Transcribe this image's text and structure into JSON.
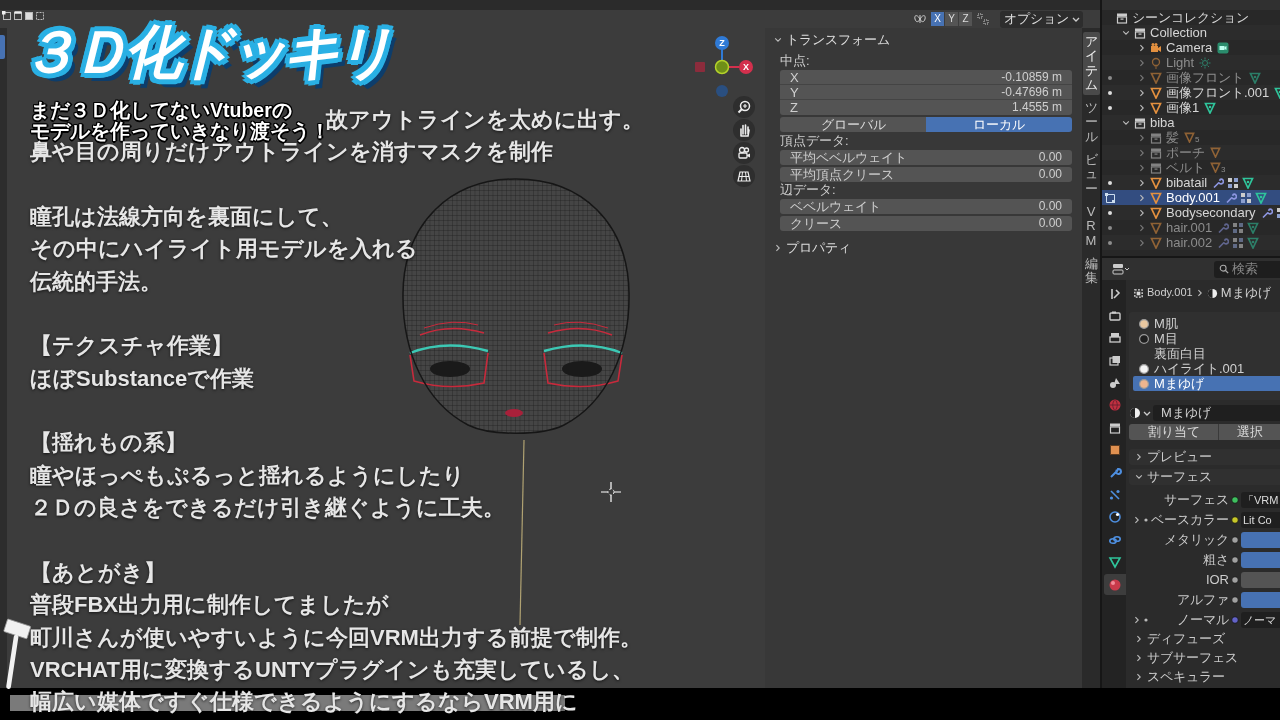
{
  "title_overlay": {
    "title": "３Ｄ化ドッキリ",
    "subtitle_lines": [
      "まだ３Ｄ化してないVtuberの",
      "モデルを作っていきなり渡そう！"
    ]
  },
  "caption": {
    "partly_covered_line": "故アウトラインを太めに出す。",
    "paragraphs": [
      [
        "鼻や目の周りだけアウトラインを消すマスクを制作"
      ],
      [
        "瞳孔は法線方向を裏面にして、",
        "その中にハイライト用モデルを入れる",
        "伝統的手法。"
      ],
      [
        "【テクスチャ作業】",
        "ほぼSubstanceで作業"
      ],
      [
        "【揺れもの系】",
        "瞳やほっぺもぷるっと揺れるようにしたり",
        "２Ｄの良さをできるだけ引き継ぐように工夫。"
      ],
      [
        "【あとがき】",
        "普段FBX出力用に制作してましたが",
        "町川さんが使いやすいように今回VRM出力する前提で制作。",
        "VRCHAT用に変換するUNTYプラグインも充実しているし、",
        "幅広い媒体ですぐ仕様できるようにするならVRM用に"
      ]
    ]
  },
  "viewport_header": {
    "mirror_axes": [
      {
        "label": "X",
        "selected": true
      },
      {
        "label": "Y",
        "selected": false
      },
      {
        "label": "Z",
        "selected": false
      }
    ],
    "options_menu": "オプション"
  },
  "gizmo": {
    "z_label": "Z",
    "x_label": "X"
  },
  "sidebar": {
    "transform": {
      "title": "トランスフォーム",
      "expanded": true,
      "median_label": "中点:",
      "median": [
        {
          "axis": "X",
          "value": "-0.10859 m"
        },
        {
          "axis": "Y",
          "value": "-0.47696 m"
        },
        {
          "axis": "Z",
          "value": "1.4555 m"
        }
      ],
      "space": [
        {
          "label": "グローバル",
          "selected": false
        },
        {
          "label": "ローカル",
          "selected": true
        }
      ],
      "groups": [
        {
          "label": "頂点データ:",
          "fields": [
            {
              "label": "平均ベベルウェイト",
              "value": "0.00"
            },
            {
              "label": "平均頂点クリース",
              "value": "0.00"
            }
          ]
        },
        {
          "label": "辺データ:",
          "fields": [
            {
              "label": "ベベルウェイト",
              "value": "0.00"
            },
            {
              "label": "クリース",
              "value": "0.00"
            }
          ]
        }
      ]
    },
    "properties_panel": {
      "title": "プロパティ",
      "expanded": false
    },
    "tabs": [
      {
        "label": "アイテム",
        "selected": true
      },
      {
        "label": "ツール",
        "selected": false
      },
      {
        "label": "ビュー",
        "selected": false
      },
      {
        "label": "VRM",
        "selected": false
      },
      {
        "label": "編集",
        "selected": false
      }
    ]
  },
  "outliner": {
    "root": "シーンコレクション",
    "items": [
      {
        "kind": "collection",
        "label": "Collection",
        "expanded": true,
        "hidden": false,
        "selected": false,
        "edit_toggle": false,
        "edit_mode": false,
        "children": [
          {
            "kind": "camera",
            "label": "Camera",
            "expanded": false,
            "hidden": false,
            "selected": false,
            "edit_toggle": false,
            "edit_mode": false
          },
          {
            "kind": "light",
            "label": "Light",
            "expanded": false,
            "hidden": true,
            "selected": false,
            "edit_toggle": false,
            "edit_mode": false
          },
          {
            "kind": "mesh",
            "label": "画像フロント",
            "expanded": false,
            "hidden": true,
            "selected": false,
            "edit_toggle": true,
            "edit_mode": false
          },
          {
            "kind": "mesh",
            "label": "画像フロント.001",
            "expanded": false,
            "hidden": false,
            "selected": false,
            "edit_toggle": true,
            "edit_mode": false
          },
          {
            "kind": "mesh",
            "label": "画像1",
            "expanded": false,
            "hidden": false,
            "selected": false,
            "edit_toggle": true,
            "edit_mode": false
          }
        ]
      },
      {
        "kind": "collection",
        "label": "biba",
        "expanded": true,
        "hidden": false,
        "selected": false,
        "edit_toggle": false,
        "edit_mode": false,
        "children": [
          {
            "kind": "collection",
            "label": "髪",
            "expanded": false,
            "hidden": true,
            "selected": false,
            "edit_toggle": false,
            "edit_mode": false,
            "count": "5"
          },
          {
            "kind": "collection",
            "label": "ポーチ",
            "expanded": false,
            "hidden": true,
            "selected": false,
            "edit_toggle": false,
            "edit_mode": false
          },
          {
            "kind": "collection",
            "label": "ベルト",
            "expanded": false,
            "hidden": true,
            "selected": false,
            "edit_toggle": false,
            "edit_mode": false,
            "count": "3"
          },
          {
            "kind": "mesh",
            "label": "bibatail",
            "expanded": false,
            "hidden": false,
            "selected": false,
            "edit_toggle": true,
            "edit_mode": false,
            "modifiers": true
          },
          {
            "kind": "mesh",
            "label": "Body.001",
            "expanded": false,
            "hidden": false,
            "selected": true,
            "edit_mode": true,
            "modifiers": true
          },
          {
            "kind": "mesh",
            "label": "Bodysecondary",
            "expanded": false,
            "hidden": false,
            "selected": false,
            "edit_toggle": true,
            "edit_mode": false,
            "modifiers": true
          },
          {
            "kind": "mesh",
            "label": "hair.001",
            "expanded": false,
            "hidden": true,
            "selected": false,
            "edit_toggle": true,
            "edit_mode": false,
            "modifiers": true
          },
          {
            "kind": "mesh",
            "label": "hair.002",
            "expanded": false,
            "hidden": true,
            "selected": false,
            "edit_toggle": true,
            "edit_mode": false,
            "modifiers": true
          }
        ]
      }
    ]
  },
  "properties": {
    "search": {
      "placeholder": "検索"
    },
    "tabs": [
      {
        "kind": "tool",
        "selected": false
      },
      {
        "kind": "render",
        "selected": false
      },
      {
        "kind": "output",
        "selected": false
      },
      {
        "kind": "view_layer",
        "selected": false
      },
      {
        "kind": "scene",
        "selected": false
      },
      {
        "kind": "world",
        "selected": false
      },
      {
        "kind": "collection",
        "selected": false
      },
      {
        "kind": "object",
        "selected": false
      },
      {
        "kind": "modifiers",
        "selected": false
      },
      {
        "kind": "particles",
        "selected": false
      },
      {
        "kind": "physics",
        "selected": false
      },
      {
        "kind": "constraints",
        "selected": false
      },
      {
        "kind": "data",
        "selected": false
      },
      {
        "kind": "material",
        "selected": true
      }
    ],
    "breadcrumb": {
      "object": "Body.001",
      "material": "Mまゆげ"
    },
    "material_slots": [
      {
        "name": "M肌",
        "color": "#e8c7a0",
        "selected": false
      },
      {
        "name": "M目",
        "color": "#1e1e1e",
        "selected": false
      },
      {
        "name": "裏面白目",
        "selected": false
      },
      {
        "name": "ハイライト.001",
        "color": "#f4f4f4",
        "selected": false
      },
      {
        "name": "Mまゆげ",
        "color": "#eeb58f",
        "selected": true
      }
    ],
    "material_name": "Mまゆげ",
    "slot_buttons": [
      "割り当て",
      "選択"
    ],
    "sections": [
      {
        "title": "プレビュー",
        "expanded": false
      },
      {
        "title": "サーフェス",
        "expanded": true,
        "inputs": [
          {
            "kind": "link",
            "label": "サーフェス",
            "expandable": false,
            "color": "#3fbf5f",
            "value": "「VRM"
          },
          {
            "kind": "link",
            "label": "ベースカラー",
            "expandable": true,
            "color": "#c7c729",
            "value": "Lit Co"
          },
          {
            "kind": "bar",
            "label": "メタリック",
            "expandable": false,
            "color": "#a1a1a1",
            "filled": true
          },
          {
            "kind": "bar",
            "label": "粗さ",
            "expandable": false,
            "color": "#a1a1a1",
            "filled": true
          },
          {
            "kind": "bar",
            "label": "IOR",
            "expandable": false,
            "color": "#a1a1a1",
            "filled": false
          },
          {
            "kind": "bar",
            "label": "アルファ",
            "expandable": false,
            "color": "#a1a1a1",
            "filled": true
          },
          {
            "kind": "link",
            "label": "ノーマル",
            "expandable": true,
            "color": "#6363c7",
            "value": "ノーマ"
          }
        ],
        "subsections": [
          {
            "title": "ディフューズ",
            "expanded": false
          },
          {
            "title": "サブサーフェス",
            "expanded": false
          },
          {
            "title": "スペキュラー",
            "expanded": false
          }
        ]
      }
    ]
  }
}
